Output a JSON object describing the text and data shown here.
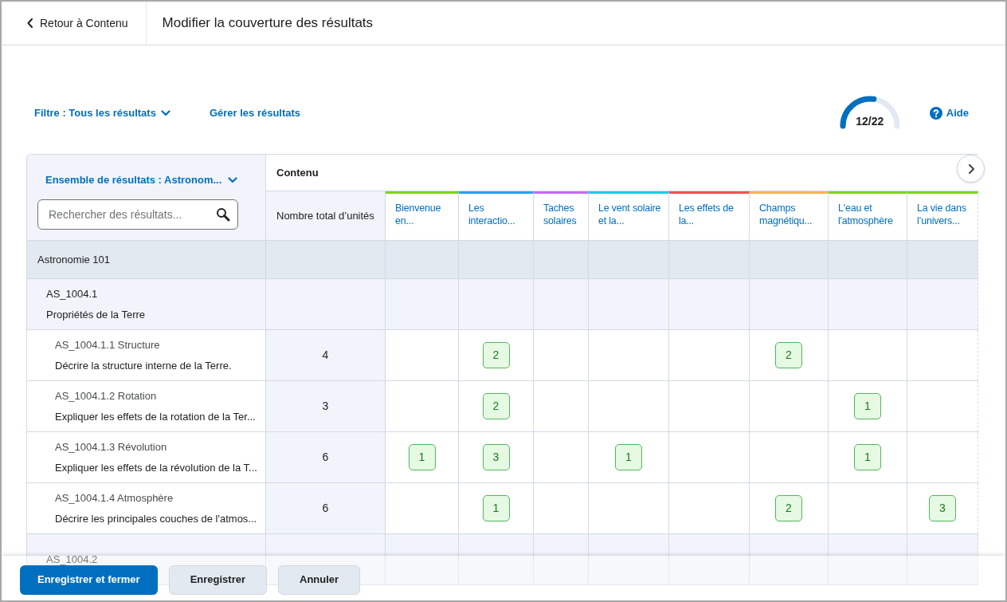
{
  "header": {
    "back_link": "Retour à Contenu",
    "title": "Modifier la couverture des résultats"
  },
  "toolbar": {
    "filter": "Filtre : Tous les résultats",
    "manage_link": "Gérer les résultats",
    "progress": {
      "level": 0.545,
      "reading": "12/22"
    },
    "help": "Aide"
  },
  "table": {
    "outcome_set": "Ensemble de résultats : Astronom...",
    "search": {
      "placeholder": "Rechercher des résultats..."
    },
    "content_heading": "Contenu",
    "total_heading": "Nombre total d’unités",
    "columns": [
      {
        "label": "Bienvenue en...",
        "color": "#7ed321"
      },
      {
        "label": "Les interactio...",
        "color": "#2ba0f0"
      },
      {
        "label": "Taches solaires",
        "color": "#c46cf0"
      },
      {
        "label": "Le vent solaire et la...",
        "color": "#1ccbe6"
      },
      {
        "label": "Les effets de la...",
        "color": "#f05252"
      },
      {
        "label": "Champs magnétiqu...",
        "color": "#f5b45a"
      },
      {
        "label": "L'eau et l'atmosphère",
        "color": "#7ed321"
      },
      {
        "label": "La vie dans l’univers...",
        "color": "#7ed321"
      }
    ],
    "rows": [
      {
        "kind": "group",
        "title": "Astronomie 101",
        "children": [
          {
            "kind": "subgroup",
            "code": "AS_1004.1",
            "title": "Propriétés de la Terre",
            "children": [
              {
                "kind": "outcome",
                "code": "AS_1004.1.1 Structure",
                "title": "Décrire la structure interne de la Terre.",
                "total": "4",
                "cells": [
                  null,
                  "2",
                  null,
                  null,
                  null,
                  "2",
                  null,
                  null
                ]
              },
              {
                "kind": "outcome",
                "code": "AS_1004.1.2 Rotation",
                "title": "Expliquer les effets de la rotation de la Ter...",
                "total": "3",
                "cells": [
                  null,
                  "2",
                  null,
                  null,
                  null,
                  null,
                  "1",
                  null
                ]
              },
              {
                "kind": "outcome",
                "code": "AS_1004.1.3 Révolution",
                "title": "Expliquer les effets de la révolution de la T...",
                "total": "6",
                "cells": [
                  "1",
                  "3",
                  null,
                  "1",
                  null,
                  null,
                  "1",
                  null
                ]
              },
              {
                "kind": "outcome",
                "code": "AS_1004.1.4 Atmosphère",
                "title": "Décrire les principales couches de l'atmos...",
                "total": "6",
                "cells": [
                  null,
                  "1",
                  null,
                  null,
                  null,
                  "2",
                  null,
                  "3"
                ]
              }
            ]
          },
          {
            "kind": "subgroup",
            "code": "AS_1004.2"
          }
        ]
      }
    ]
  },
  "footer": {
    "buttons": [
      {
        "label": "Enregistrer et fermer",
        "kind": "primary"
      },
      {
        "label": "Enregistrer",
        "kind": "secondary"
      },
      {
        "label": "Annuler",
        "kind": "secondary"
      }
    ]
  }
}
